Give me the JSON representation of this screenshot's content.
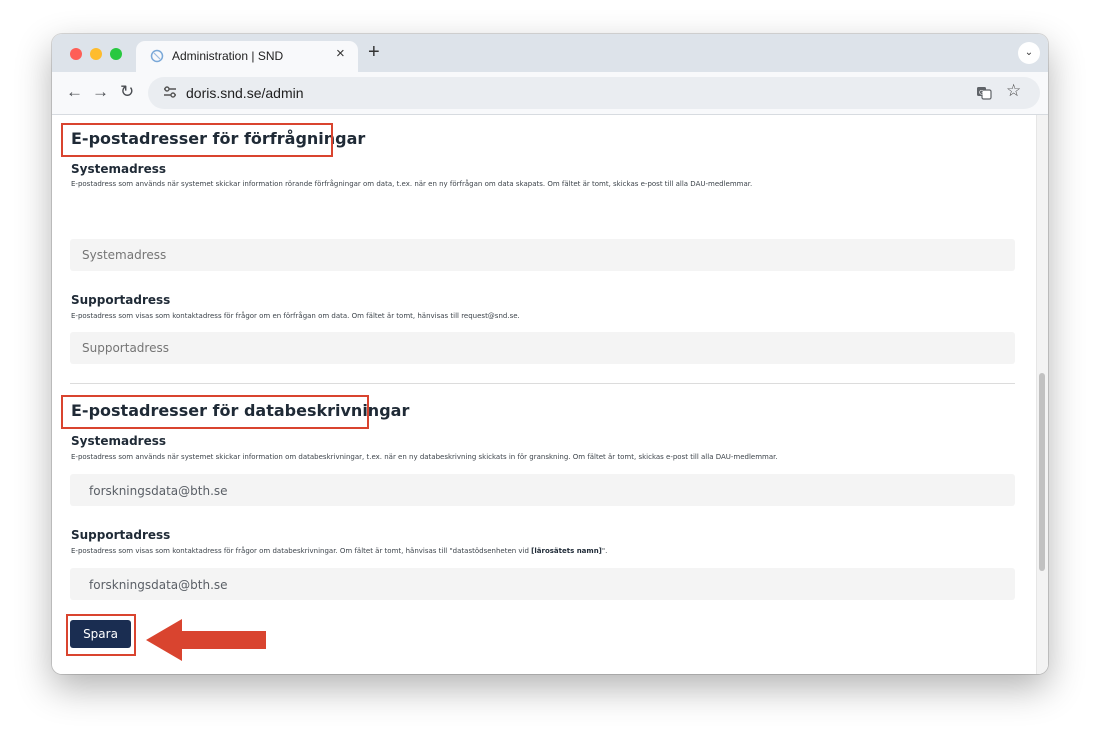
{
  "browser": {
    "tab_title": "Administration | SND",
    "tab_close": "×",
    "new_tab": "+",
    "tab_menu": "⌄",
    "url": "doris.snd.se/admin"
  },
  "sections": [
    {
      "heading": "E-postadresser för förfrågningar",
      "system_title": "Systemadress",
      "system_desc": "E-postadress som används när systemet skickar information rörande förfrågningar om data, t.ex. när en ny förfrågan om data skapats. Om fältet är tomt, skickas e-post till alla DAU-medlemmar.",
      "system_placeholder": "Systemadress",
      "system_value": "",
      "support_title": "Supportadress",
      "support_desc": "E-postadress som visas som kontaktadress för frågor om en förfrågan om data. Om fältet är tomt, hänvisas till request@snd.se.",
      "support_placeholder": "Supportadress",
      "support_value": ""
    },
    {
      "heading": "E-postadresser för databeskrivningar",
      "system_title": "Systemadress",
      "system_desc": "E-postadress som används när systemet skickar information om databeskrivningar, t.ex. när en ny databeskrivning skickats in för granskning. Om fältet är tomt, skickas e-post till alla DAU-medlemmar.",
      "system_value": "forskningsdata@bth.se",
      "support_title": "Supportadress",
      "support_desc_prefix": "E-postadress som visas som kontaktadress för frågor om databeskrivningar. Om fältet är tomt, hänvisas till \"datastödsenheten vid ",
      "support_desc_bold": "[lärosätets namn]",
      "support_desc_suffix": "\".",
      "support_value": "forskningsdata@bth.se"
    }
  ],
  "save_label": "Spara",
  "colors": {
    "annotation": "#d9442f",
    "save_button": "#1a2d51"
  }
}
